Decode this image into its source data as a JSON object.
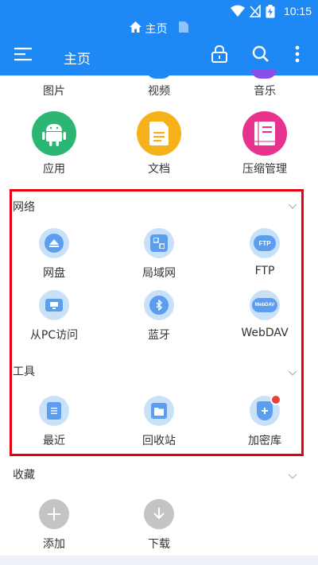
{
  "status": {
    "time": "10:15"
  },
  "breadcrumb": {
    "label": "主页"
  },
  "toolbar": {
    "title": "主页"
  },
  "top_items": [
    {
      "label": "图片"
    },
    {
      "label": "视频"
    },
    {
      "label": "音乐"
    }
  ],
  "apps": [
    {
      "label": "应用",
      "color": "#2bb673",
      "icon": "android-icon"
    },
    {
      "label": "文档",
      "color": "#f7b21b",
      "icon": "document-icon"
    },
    {
      "label": "压缩管理",
      "color": "#e8338e",
      "icon": "archive-icon"
    }
  ],
  "network": {
    "title": "网络",
    "items": [
      {
        "label": "网盘",
        "icon": "cloud-icon"
      },
      {
        "label": "局域网",
        "icon": "lan-icon"
      },
      {
        "label": "FTP",
        "icon": "ftp-icon",
        "badge": "FTP"
      },
      {
        "label": "从PC访问",
        "icon": "pc-icon"
      },
      {
        "label": "蓝牙",
        "icon": "bluetooth-icon"
      },
      {
        "label": "WebDAV",
        "icon": "webdav-icon",
        "badge": "WebDAV"
      }
    ]
  },
  "tools": {
    "title": "工具",
    "items": [
      {
        "label": "最近",
        "icon": "recent-icon"
      },
      {
        "label": "回收站",
        "icon": "recycle-bin-icon"
      },
      {
        "label": "加密库",
        "icon": "vault-icon"
      }
    ]
  },
  "favorites": {
    "title": "收藏",
    "items": [
      {
        "label": "添加",
        "icon": "plus-icon"
      },
      {
        "label": "下载",
        "icon": "download-icon"
      }
    ]
  },
  "colors": {
    "accent": "#1e88f5",
    "highlight": "#e60012"
  }
}
